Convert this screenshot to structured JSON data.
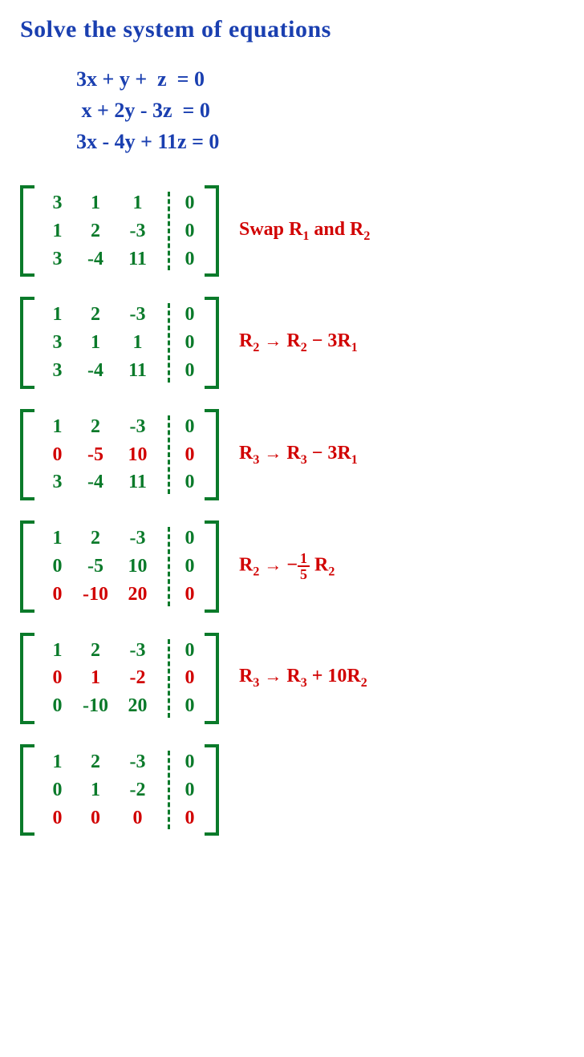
{
  "title": "Solve the system of equations",
  "equations": [
    "3x + y +  z  = 0",
    " x + 2y - 3z  = 0",
    "3x - 4y + 11z = 0"
  ],
  "steps": [
    {
      "matrix": [
        [
          "3",
          "1",
          "1"
        ],
        [
          "1",
          "2",
          "-3"
        ],
        [
          "3",
          "-4",
          "11"
        ]
      ],
      "rhs": [
        "0",
        "0",
        "0"
      ],
      "highlight_rows": [],
      "op_html": "Swap R<sub>1</sub> and R<sub>2</sub>"
    },
    {
      "matrix": [
        [
          "1",
          "2",
          "-3"
        ],
        [
          "3",
          "1",
          "1"
        ],
        [
          "3",
          "-4",
          "11"
        ]
      ],
      "rhs": [
        "0",
        "0",
        "0"
      ],
      "highlight_rows": [],
      "op_html": "R<sub>2</sub> <span class='arrow'>→</span> R<sub>2</sub> − 3R<sub>1</sub>"
    },
    {
      "matrix": [
        [
          "1",
          "2",
          "-3"
        ],
        [
          "0",
          "-5",
          "10"
        ],
        [
          "3",
          "-4",
          "11"
        ]
      ],
      "rhs": [
        "0",
        "0",
        "0"
      ],
      "highlight_rows": [
        1
      ],
      "op_html": "R<sub>3</sub> <span class='arrow'>→</span> R<sub>3</sub> − 3R<sub>1</sub>"
    },
    {
      "matrix": [
        [
          "1",
          "2",
          "-3"
        ],
        [
          "0",
          "-5",
          "10"
        ],
        [
          "0",
          "-10",
          "20"
        ]
      ],
      "rhs": [
        "0",
        "0",
        "0"
      ],
      "highlight_rows": [
        2
      ],
      "op_html": "R<sub>2</sub> <span class='arrow'>→</span> −<span class='frac'><span class='num'>1</span><span class='den'>5</span></span> R<sub>2</sub>"
    },
    {
      "matrix": [
        [
          "1",
          "2",
          "-3"
        ],
        [
          "0",
          "1",
          "-2"
        ],
        [
          "0",
          "-10",
          "20"
        ]
      ],
      "rhs": [
        "0",
        "0",
        "0"
      ],
      "highlight_rows": [
        1
      ],
      "op_html": "R<sub>3</sub> <span class='arrow'>→</span> R<sub>3</sub> + 10R<sub>2</sub>"
    },
    {
      "matrix": [
        [
          "1",
          "2",
          "-3"
        ],
        [
          "0",
          "1",
          "-2"
        ],
        [
          "0",
          "0",
          "0"
        ]
      ],
      "rhs": [
        "0",
        "0",
        "0"
      ],
      "highlight_rows": [
        2
      ],
      "op_html": ""
    }
  ]
}
